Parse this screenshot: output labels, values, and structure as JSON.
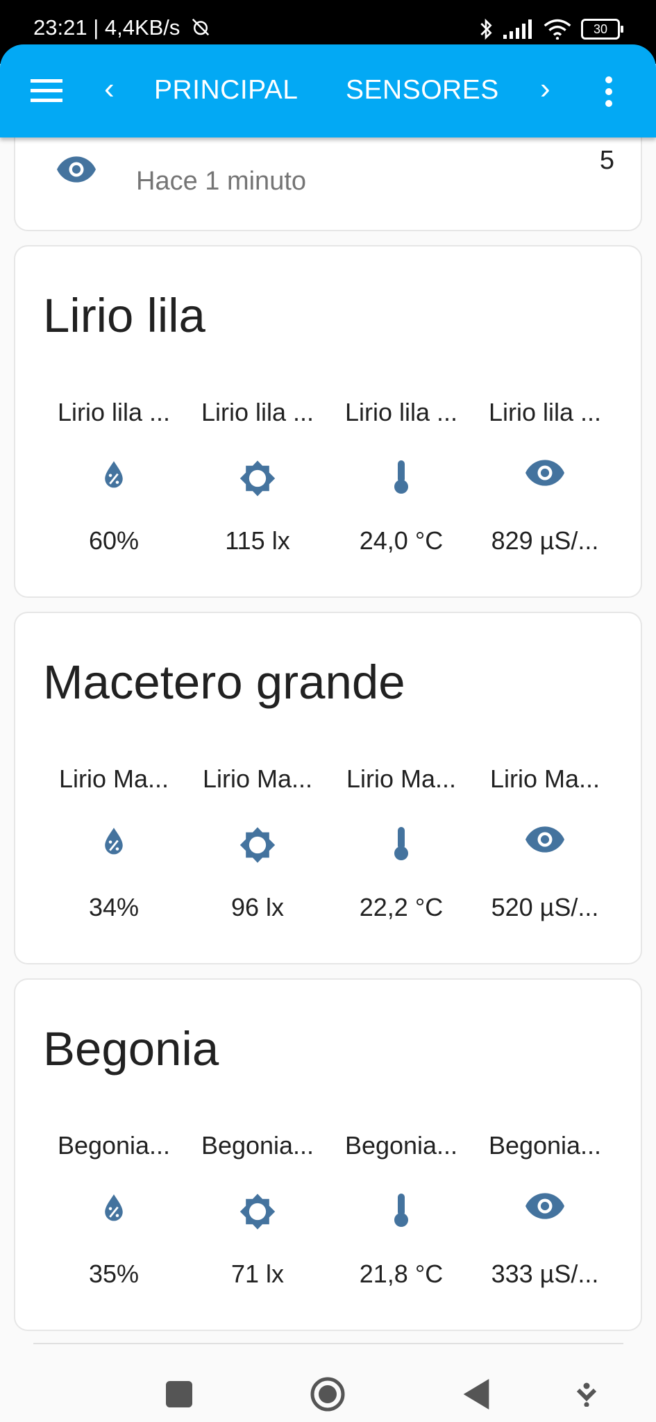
{
  "status_bar": {
    "time_speed": "23:21 | 4,4KB/s",
    "battery": "30"
  },
  "app_bar": {
    "tabs": [
      "PRINCIPAL",
      "SENSORES"
    ],
    "back_chevron": "‹",
    "forward_chevron": "›"
  },
  "top_card": {
    "subtitle": "Hace 1 minuto",
    "value": "5",
    "icon": "eye-icon"
  },
  "cards": [
    {
      "title": "Lirio lila",
      "entities": [
        {
          "name": "Lirio lila ...",
          "icon": "water-percent-icon",
          "value": "60%"
        },
        {
          "name": "Lirio lila ...",
          "icon": "brightness-icon",
          "value": "115 lx"
        },
        {
          "name": "Lirio lila ...",
          "icon": "thermometer-icon",
          "value": "24,0 °C"
        },
        {
          "name": "Lirio lila ...",
          "icon": "eye-icon",
          "value": "829 µS/..."
        }
      ]
    },
    {
      "title": "Macetero grande",
      "entities": [
        {
          "name": "Lirio Ma...",
          "icon": "water-percent-icon",
          "value": "34%"
        },
        {
          "name": "Lirio Ma...",
          "icon": "brightness-icon",
          "value": "96 lx"
        },
        {
          "name": "Lirio Ma...",
          "icon": "thermometer-icon",
          "value": "22,2 °C"
        },
        {
          "name": "Lirio Ma...",
          "icon": "eye-icon",
          "value": "520 µS/..."
        }
      ]
    },
    {
      "title": "Begonia",
      "entities": [
        {
          "name": "Begonia...",
          "icon": "water-percent-icon",
          "value": "35%"
        },
        {
          "name": "Begonia...",
          "icon": "brightness-icon",
          "value": "71 lx"
        },
        {
          "name": "Begonia...",
          "icon": "thermometer-icon",
          "value": "21,8 °C"
        },
        {
          "name": "Begonia...",
          "icon": "eye-icon",
          "value": "333 µS/..."
        }
      ]
    }
  ],
  "colors": {
    "app_bar": "#03a9f4",
    "icon": "#44739e",
    "background": "#fafafa"
  }
}
